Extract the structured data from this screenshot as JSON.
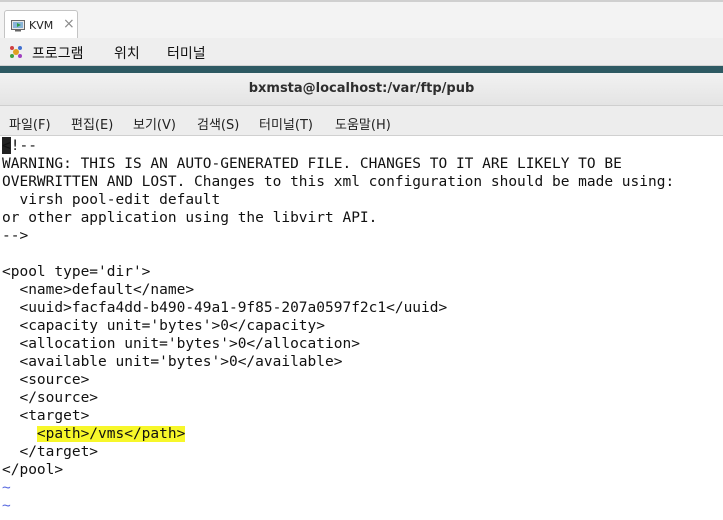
{
  "vm_tab": {
    "label": "KVM",
    "close": "×"
  },
  "gnome_menu": {
    "programs": "프로그램",
    "places": "위치",
    "terminal": "터미널"
  },
  "terminal": {
    "title": "bxmsta@localhost:/var/ftp/pub",
    "menu": [
      "파일(F)",
      "편집(E)",
      "보기(V)",
      "검색(S)",
      "터미널(T)",
      "도움말(H)"
    ],
    "lines": [
      "<!--",
      "WARNING: THIS IS AN AUTO-GENERATED FILE. CHANGES TO IT ARE LIKELY TO BE",
      "OVERWRITTEN AND LOST. Changes to this xml configuration should be made using:",
      "  virsh pool-edit default",
      "or other application using the libvirt API.",
      "-->",
      "",
      "<pool type='dir'>",
      "  <name>default</name>",
      "  <uuid>facfa4dd-b490-49a1-9f85-207a0597f2c1</uuid>",
      "  <capacity unit='bytes'>0</capacity>",
      "  <allocation unit='bytes'>0</allocation>",
      "  <available unit='bytes'>0</available>",
      "  <source>",
      "  </source>",
      "  <target>",
      "    <path>/vms</path>",
      "  </target>",
      "</pool>",
      "~",
      "~"
    ]
  }
}
